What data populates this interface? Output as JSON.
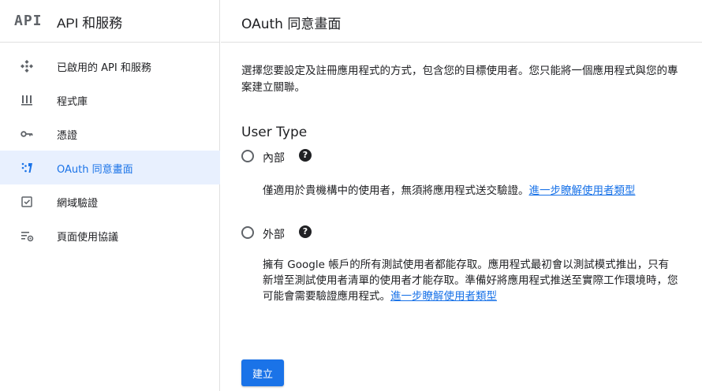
{
  "brand": {
    "logo": "API",
    "title": "API 和服務"
  },
  "sidebar": {
    "items": [
      {
        "label": "已啟用的 API 和服務",
        "icon": "api-diamond-icon",
        "active": false
      },
      {
        "label": "程式庫",
        "icon": "library-icon",
        "active": false
      },
      {
        "label": "憑證",
        "icon": "key-icon",
        "active": false
      },
      {
        "label": "OAuth 同意畫面",
        "icon": "oauth-consent-icon",
        "active": true
      },
      {
        "label": "網域驗證",
        "icon": "checkbox-icon",
        "active": false
      },
      {
        "label": "頁面使用協議",
        "icon": "settings-list-icon",
        "active": false
      }
    ]
  },
  "header": {
    "title": "OAuth 同意畫面"
  },
  "main": {
    "description": "選擇您要設定及註冊應用程式的方式，包含您的目標使用者。您只能將一個應用程式與您的專案建立關聯。",
    "user_type_title": "User Type",
    "options": [
      {
        "label": "內部",
        "help": "?",
        "description": "僅適用於貴機構中的使用者，無須將應用程式送交驗證。",
        "link": "進一步瞭解使用者類型"
      },
      {
        "label": "外部",
        "help": "?",
        "description": "擁有 Google 帳戶的所有測試使用者都能存取。應用程式最初會以測試模式推出，只有新增至測試使用者清單的使用者才能存取。準備好將應用程式推送至實際工作環境時，您可能會需要驗證應用程式。",
        "link": "進一步瞭解使用者類型"
      }
    ],
    "create_label": "建立"
  },
  "colors": {
    "accent": "#1a73e8",
    "active_bg": "#e8f0fe",
    "icon": "#5f6368"
  }
}
